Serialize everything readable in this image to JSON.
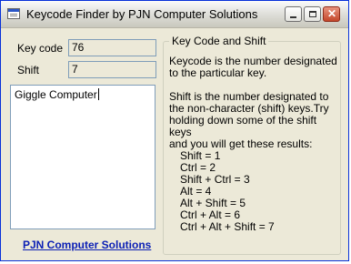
{
  "window": {
    "title": "Keycode Finder by PJN Computer Solutions",
    "buttons": {
      "minimize": "minimize",
      "maximize": "maximize",
      "close": "✕"
    }
  },
  "fields": {
    "keycode_label": "Key code",
    "keycode_value": "76",
    "shift_label": "Shift",
    "shift_value": "7"
  },
  "input_text": "Giggle Computer",
  "link_text": "PJN Computer Solutions",
  "group": {
    "title": "Key Code and Shift",
    "para1_line1": "Keycode is the number designated",
    "para1_line2": "to the particular key.",
    "para2_line1": "Shift is the number designated to",
    "para2_line2": "the non-character (shift) keys.Try",
    "para2_line3": "holding down some of the shift keys",
    "para2_line4": "and you will get these results:",
    "results": [
      "Shift = 1",
      "Ctrl = 2",
      "Shift + Ctrl = 3",
      "Alt = 4",
      "Alt + Shift = 5",
      "Ctrl + Alt = 6",
      "Ctrl + Alt + Shift = 7"
    ]
  },
  "icons": [
    "app-icon",
    "minimize-icon",
    "maximize-icon",
    "close-icon"
  ],
  "colors": {
    "window_bg": "#ece9d8",
    "link": "#0b1fb5",
    "border": "#0831d9"
  }
}
